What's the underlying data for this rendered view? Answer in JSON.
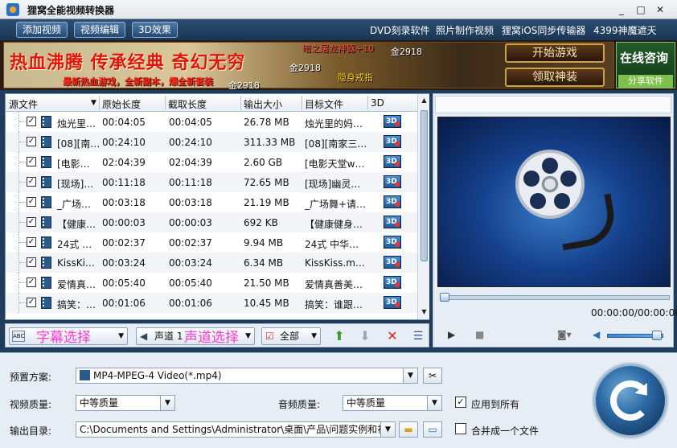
{
  "window": {
    "title": "狸窝全能视频转换器",
    "controls": [
      "_",
      "□",
      "✕"
    ]
  },
  "toolbar": {
    "add_video": "添加视频",
    "edit_video": "视频编辑",
    "effect_3d": "3D效果",
    "links": [
      "DVD刻录软件",
      "照片制作视频",
      "狸窝iOS同步传输器",
      "4399神魔遮天"
    ]
  },
  "banner": {
    "slogan": "热血沸腾 传承经典 奇幻无穷",
    "sub": "最新热血游戏，全新副本，爆全新套装",
    "gold_texts": [
      "暗之屠龙神器+10",
      "金2918",
      "金2918",
      "隐身戒指",
      "金2918"
    ],
    "start_game": "开始游戏",
    "get_gear": "领取神装",
    "consult": "在线咨询",
    "share": "分享软件"
  },
  "table": {
    "headers": [
      "源文件",
      "原始长度",
      "截取长度",
      "输出大小",
      "目标文件",
      "3D"
    ],
    "rows": [
      {
        "name": "烛光里…",
        "orig": "00:04:05",
        "cut": "00:04:05",
        "size": "26.78 MB",
        "target": "烛光里的妈…"
      },
      {
        "name": "[08][南…",
        "orig": "00:24:10",
        "cut": "00:24:10",
        "size": "311.33 MB",
        "target": "[08][南家三…"
      },
      {
        "name": "[电影…",
        "orig": "02:04:39",
        "cut": "02:04:39",
        "size": "2.60 GB",
        "target": "[电影天堂w…"
      },
      {
        "name": "[现场]…",
        "orig": "00:11:18",
        "cut": "00:11:18",
        "size": "72.65 MB",
        "target": "[现场]幽灵…"
      },
      {
        "name": "_广场…",
        "orig": "00:03:18",
        "cut": "00:03:18",
        "size": "21.19 MB",
        "target": "_广场舞+请…"
      },
      {
        "name": "【健康…",
        "orig": "00:00:03",
        "cut": "00:00:03",
        "size": "692 KB",
        "target": "【健康健身…"
      },
      {
        "name": "24式 …",
        "orig": "00:02:37",
        "cut": "00:02:37",
        "size": "9.94 MB",
        "target": "24式 中华…"
      },
      {
        "name": "KissKi…",
        "orig": "00:03:24",
        "cut": "00:03:24",
        "size": "6.34 MB",
        "target": "KissKiss.m…"
      },
      {
        "name": "爱情真…",
        "orig": "00:05:40",
        "cut": "00:05:40",
        "size": "21.50 MB",
        "target": "爱情真善美…"
      },
      {
        "name": "搞笑：…",
        "orig": "00:01:06",
        "cut": "00:01:06",
        "size": "10.45 MB",
        "target": "搞笑：谁跟…"
      }
    ],
    "badge_3d": "3D"
  },
  "controls": {
    "subtitle_hint": "字幕选择",
    "audio_track": "声道 1",
    "audio_hint": "声道选择",
    "select_all": "全部"
  },
  "preview": {
    "time": "00:00:00/00:00:00"
  },
  "settings": {
    "preset_label": "预置方案:",
    "preset_value": "MP4-MPEG-4 Video(*.mp4)",
    "video_quality_label": "视频质量:",
    "video_quality_value": "中等质量",
    "audio_quality_label": "音频质量:",
    "audio_quality_value": "中等质量",
    "apply_all": "应用到所有",
    "output_label": "输出目录:",
    "output_path": "C:\\Documents and Settings\\Administrator\\桌面\\产品\\问题实例和视…",
    "merge": "合并成一个文件"
  }
}
